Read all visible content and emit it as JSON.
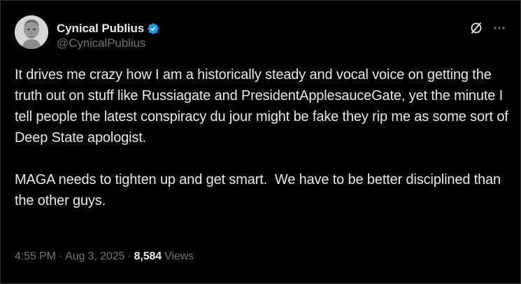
{
  "author": {
    "display_name": "Cynical Publius",
    "handle": "@CynicalPublius",
    "verified_badge_color": "#1d9bf0",
    "avatar_icon": "classical-bust-avatar"
  },
  "actions": {
    "grok_icon": "grok-slash-circle-icon",
    "more_icon": "more-horizontal-icon"
  },
  "post": {
    "paragraph_1": "It drives me crazy how I am a historically steady and vocal voice on getting the truth out on stuff like Russiagate and PresidentApplesauceGate, yet the minute I tell people the latest conspiracy du jour might be fake they rip me as some sort of Deep State apologist.",
    "paragraph_2": "MAGA needs to tighten up and get smart.  We have to be better disciplined than the other guys."
  },
  "meta": {
    "time": "4:55 PM",
    "date": "Aug 3, 2025",
    "separator": "·",
    "views_count": "8,584",
    "views_label": "Views"
  },
  "colors": {
    "background": "#000000",
    "primary_text": "#e7e9ea",
    "secondary_text": "#71767b",
    "accent": "#1d9bf0"
  }
}
